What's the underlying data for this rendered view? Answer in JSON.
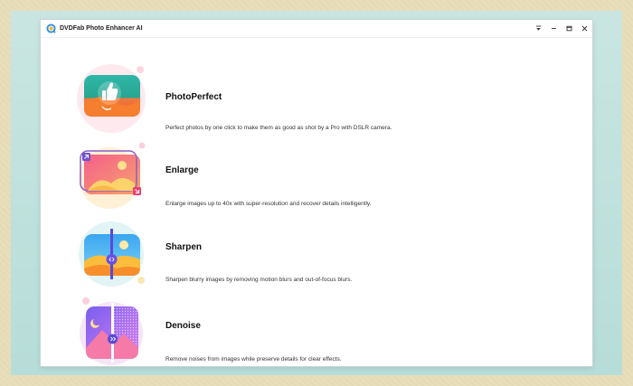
{
  "window": {
    "title": "DVDFab Photo Enhancer AI"
  },
  "controls": {
    "menu_icon": "menu-down-icon",
    "min_icon": "minimize-icon",
    "max_icon": "maximize-icon",
    "close_icon": "close-icon"
  },
  "features": [
    {
      "title": "PhotoPerfect",
      "description": "Perfect photos by one click to make them as good as shot by a Pro with DSLR camera.",
      "icon": "thumbs-up-photo-icon"
    },
    {
      "title": "Enlarge",
      "description": "Enlarge images up to 40x with super-resolution and recover details intelligently.",
      "icon": "enlarge-photo-icon"
    },
    {
      "title": "Sharpen",
      "description": "Sharpen blurry images by removing motion blurs and out-of-focus blurs.",
      "icon": "sharpen-photo-icon"
    },
    {
      "title": "Denoise",
      "description": "Remove noises from images while preserve details for clear effects.",
      "icon": "denoise-photo-icon"
    }
  ]
}
